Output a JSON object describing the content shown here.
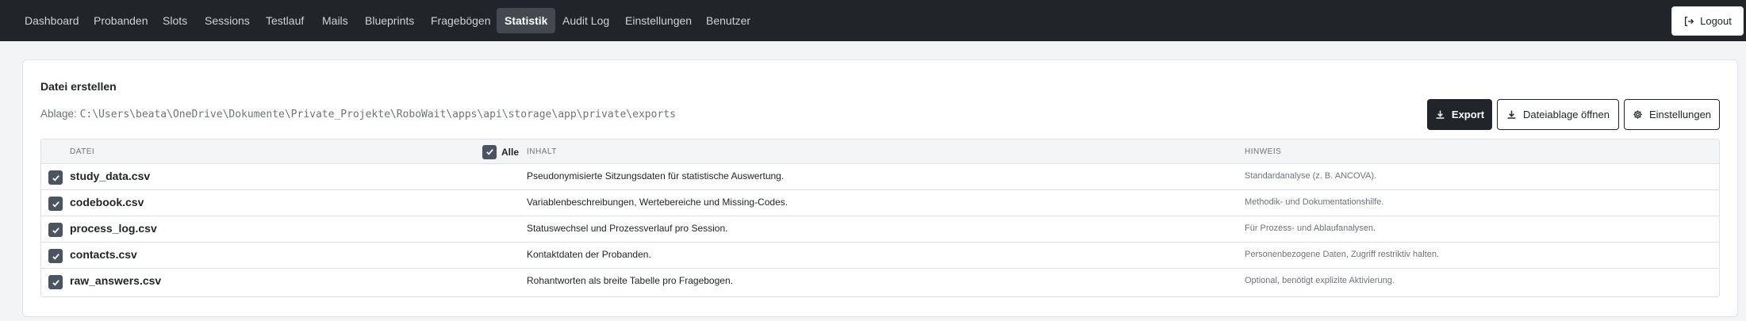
{
  "nav": {
    "items": [
      {
        "label": "Dashboard"
      },
      {
        "label": "Probanden"
      },
      {
        "label": "Slots"
      },
      {
        "label": "Sessions"
      },
      {
        "label": "Testlauf"
      },
      {
        "label": "Mails"
      },
      {
        "label": "Blueprints"
      },
      {
        "label": "Fragebögen"
      },
      {
        "label": "Statistik",
        "active": true
      },
      {
        "label": "Audit Log"
      },
      {
        "label": "Einstellungen"
      },
      {
        "label": "Benutzer"
      }
    ],
    "logout_label": "Logout",
    "logout_icon": "logout-icon"
  },
  "card": {
    "title": "Datei erstellen",
    "path_label": "Ablage:",
    "path_value": "C:\\Users\\beata\\OneDrive\\Dokumente\\Private_Projekte\\RoboWait\\apps\\api\\storage\\app\\private\\exports",
    "buttons": {
      "export": "Export",
      "open_folder": "Dateiablage öffnen",
      "settings": "Einstellungen"
    }
  },
  "table": {
    "headers": {
      "file": "Datei",
      "all": "Alle",
      "content": "Inhalt",
      "hint": "Hinweis"
    },
    "rows": [
      {
        "file": "study_data.csv",
        "content": "Pseudonymisierte Sitzungsdaten für statistische Auswertung.",
        "hint": "Standardanalyse (z. B. ANCOVA).",
        "checked": true
      },
      {
        "file": "codebook.csv",
        "content": "Variablenbeschreibungen, Wertebereiche und Missing-Codes.",
        "hint": "Methodik- und Dokumentationshilfe.",
        "checked": true
      },
      {
        "file": "process_log.csv",
        "content": "Statuswechsel und Prozessverlauf pro Session.",
        "hint": "Für Prozess- und Ablaufanalysen.",
        "checked": true
      },
      {
        "file": "contacts.csv",
        "content": "Kontaktdaten der Probanden.",
        "hint": "Personenbezogene Daten, Zugriff restriktiv halten.",
        "checked": true
      },
      {
        "file": "raw_answers.csv",
        "content": "Rohantworten als breite Tabelle pro Fragebogen.",
        "hint": "Optional, benötigt explizite Aktivierung.",
        "checked": true
      }
    ]
  },
  "colors": {
    "navbar": "#212529",
    "active_nav": "#43494f",
    "checkbox": "#4a5561",
    "primary_button": "#212529"
  }
}
